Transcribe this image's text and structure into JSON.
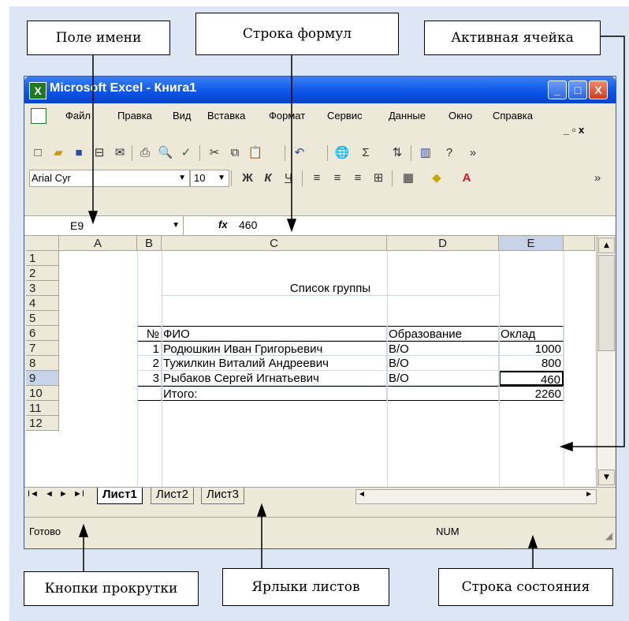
{
  "callouts": {
    "name_box": "Поле имени",
    "formula_bar": "Строка формул",
    "active_cell": "Активная ячейка",
    "scroll_buttons": "Кнопки прокрутки",
    "sheet_tabs": "Ярлыки листов",
    "status_bar": "Строка состояния"
  },
  "window": {
    "title": "Microsoft Excel - Книга1",
    "icon": "excel-icon",
    "buttons": [
      "_",
      "□",
      "X"
    ]
  },
  "menu": {
    "items": [
      "Файл",
      "Правка",
      "Вид",
      "Вставка",
      "Формат",
      "Сервис",
      "Данные",
      "Окно",
      "Справка"
    ],
    "doc_controls": "_ ▫ x"
  },
  "toolbar": {
    "font": "Arial Cyr",
    "font_size": "10",
    "bold": "Ж",
    "italic": "К",
    "underline": "Ч"
  },
  "formula_bar": {
    "name_box": "E9",
    "fx": "fx",
    "value": "460"
  },
  "sheet": {
    "columns": [
      "A",
      "B",
      "C",
      "D",
      "E"
    ],
    "rows": [
      "1",
      "2",
      "3",
      "4",
      "5",
      "6",
      "7",
      "8",
      "9",
      "10",
      "11",
      "12"
    ],
    "title": "Список группы",
    "header": {
      "num": "№",
      "fio": "ФИО",
      "edu": "Образование",
      "salary": "Оклад"
    },
    "records": [
      {
        "num": "1",
        "fio": "Родюшкин Иван Григорьевич",
        "edu": "В/О",
        "salary": "1000"
      },
      {
        "num": "2",
        "fio": "Тужилкин Виталий Андреевич",
        "edu": "В/О",
        "salary": "800"
      },
      {
        "num": "3",
        "fio": "Рыбаков Сергей Игнатьевич",
        "edu": "В/О",
        "salary": "460"
      }
    ],
    "total_label": "Итого:",
    "total_value": "2260"
  },
  "tabs": {
    "nav": [
      "I◄",
      "◄",
      "►",
      "►I"
    ],
    "sheets": [
      "Лист1",
      "Лист2",
      "Лист3"
    ],
    "active": "Лист1"
  },
  "status": {
    "ready": "Готово",
    "num": "NUM"
  },
  "colors": {
    "title_bar": "#0a53e6",
    "close_button": "#e0441c",
    "frame_bg": "#dce6f5",
    "chrome": "#ece9d8"
  }
}
